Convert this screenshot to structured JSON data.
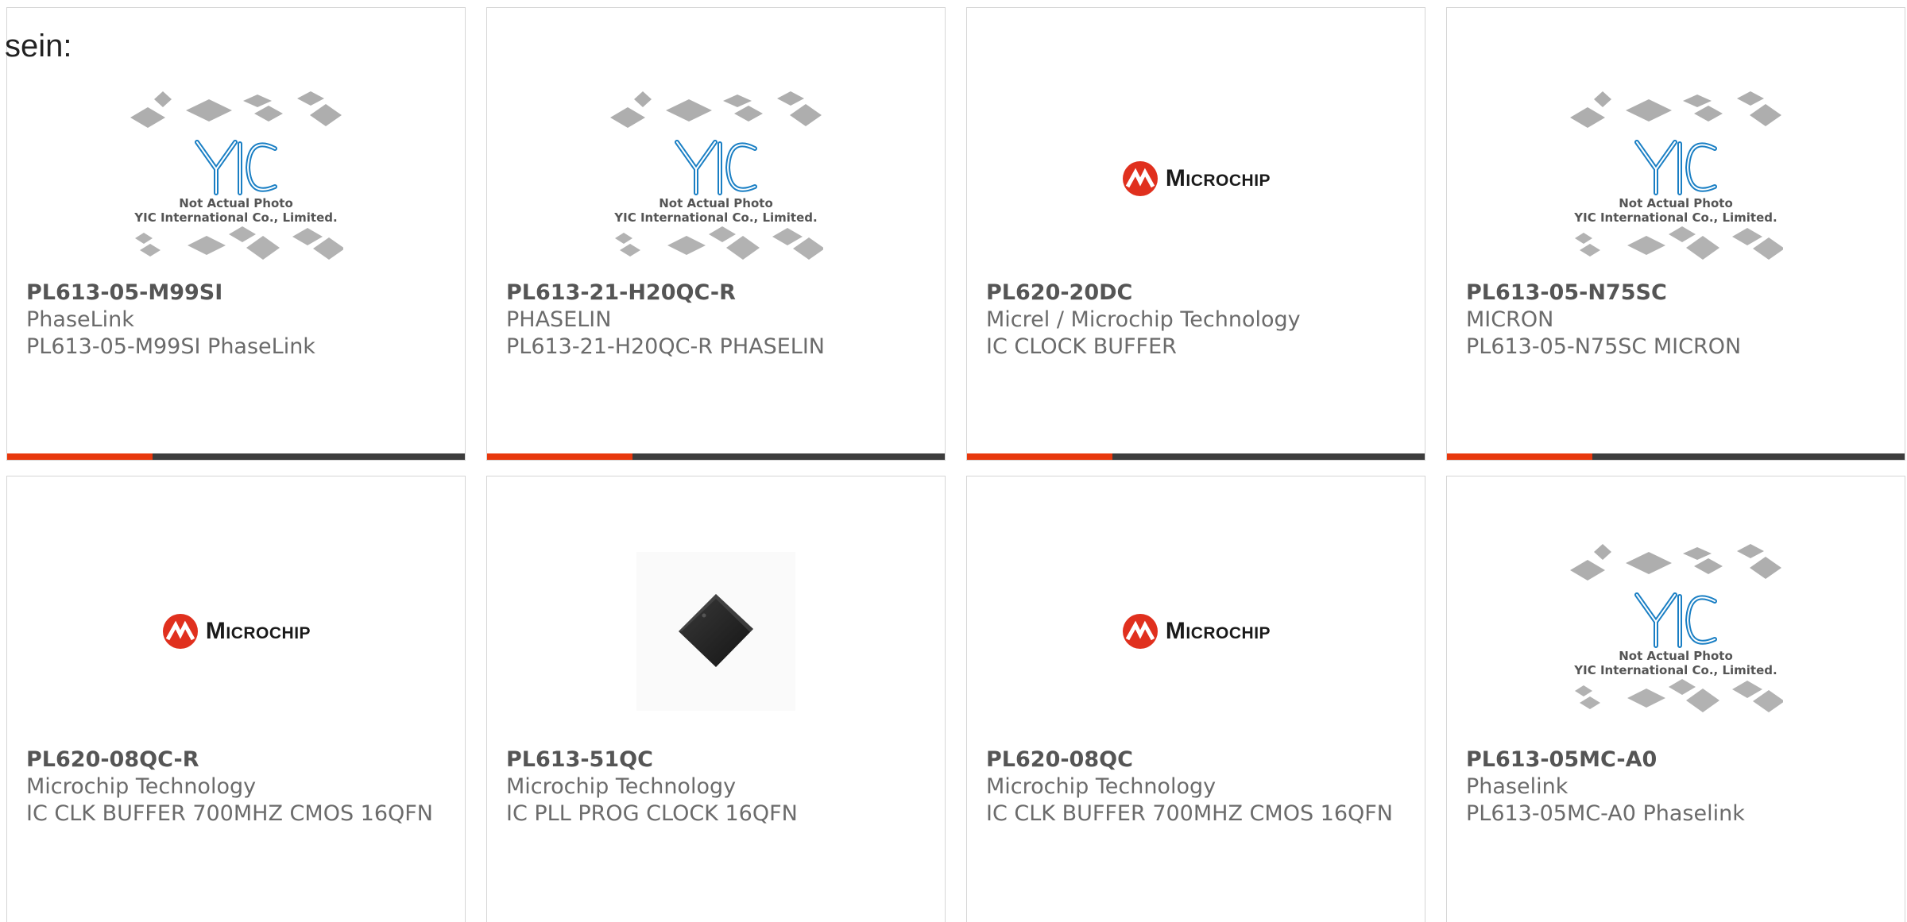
{
  "intro_text": "sein:",
  "placeholder_image": {
    "line1": "Not Actual Photo",
    "line2": "YIC International Co., Limited."
  },
  "brand_logo_text": "Microchip",
  "colors": {
    "accent": "#e8380d",
    "bar": "#3d3d3d",
    "yic_blue": "#1a7fc4",
    "microchip_red": "#e0301e"
  },
  "products": [
    {
      "part": "PL613-05-M99SI",
      "manufacturer": "PhaseLink",
      "description": "PL613-05-M99SI PhaseLink",
      "image": "yic-placeholder"
    },
    {
      "part": "PL613-21-H20QC-R",
      "manufacturer": "PHASELIN",
      "description": "PL613-21-H20QC-R PHASELIN",
      "image": "yic-placeholder"
    },
    {
      "part": "PL620-20DC",
      "manufacturer": "Micrel / Microchip Technology",
      "description": "IC CLOCK BUFFER",
      "image": "microchip-logo"
    },
    {
      "part": "PL613-05-N75SC",
      "manufacturer": "MICRON",
      "description": "PL613-05-N75SC MICRON",
      "image": "yic-placeholder"
    },
    {
      "part": "PL620-08QC-R",
      "manufacturer": "Microchip Technology",
      "description": "IC CLK BUFFER 700MHZ CMOS 16QFN",
      "image": "microchip-logo"
    },
    {
      "part": "PL613-51QC",
      "manufacturer": "Microchip Technology",
      "description": "IC PLL PROG CLOCK 16QFN",
      "image": "chip-photo"
    },
    {
      "part": "PL620-08QC",
      "manufacturer": "Microchip Technology",
      "description": "IC CLK BUFFER 700MHZ CMOS 16QFN",
      "image": "microchip-logo"
    },
    {
      "part": "PL613-05MC-A0",
      "manufacturer": "Phaselink",
      "description": "PL613-05MC-A0 Phaselink",
      "image": "yic-placeholder"
    }
  ]
}
